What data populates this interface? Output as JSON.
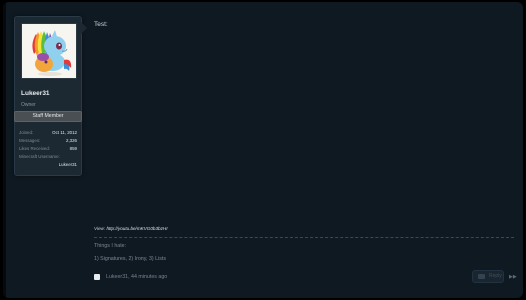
{
  "user": {
    "name": "Lukeer31",
    "role": "Owner",
    "banner": "Staff Member",
    "avatar_icon": "pony-avatar-icon",
    "stats": {
      "joined_label": "Joined:",
      "joined_value": "Oct 11, 2012",
      "messages_label": "Messages:",
      "messages_value": "2,326",
      "likes_label": "Likes Received:",
      "likes_value": "859",
      "minecraft_label": "Minecraft Username:",
      "minecraft_value": "Lukeer31"
    }
  },
  "post": {
    "body": "Test:",
    "view_prefix": "View:",
    "view_url": "http://youtu.be/mKVG0b3bzHI"
  },
  "signature": {
    "line1": "Things I hate:",
    "line2": "1) Signatures, 2) Irony, 3) Lists"
  },
  "footer": {
    "meta": "Lukeer31, 44 minutes ago",
    "reply_label": "Reply",
    "more_icon": "more-arrows-icon"
  },
  "colors": {
    "background": "#0f1922",
    "card": "#1c2832",
    "banner": "#4a4f54"
  }
}
